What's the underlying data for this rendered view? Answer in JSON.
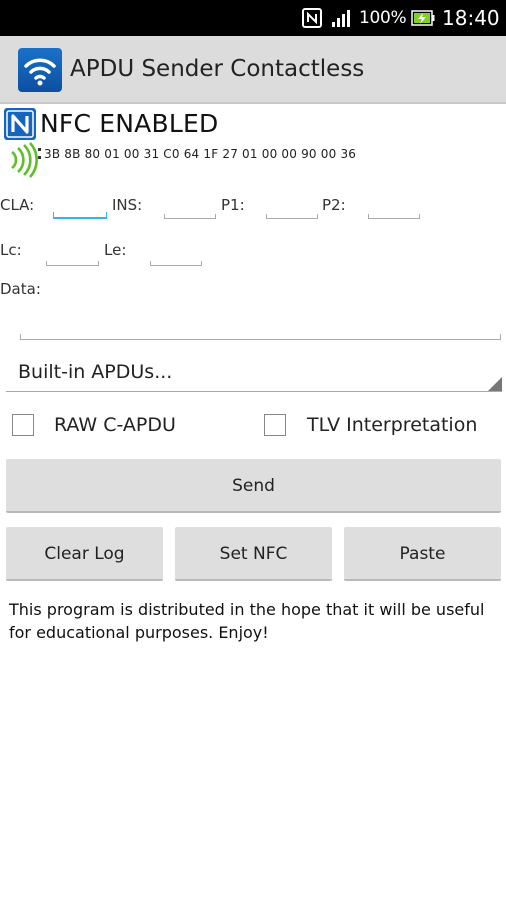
{
  "status_bar": {
    "battery_percent": "100%",
    "time": "18:40",
    "icons": [
      "nfc-icon",
      "signal-icon",
      "battery-charging-icon"
    ]
  },
  "action_bar": {
    "title": "APDU Sender Contactless",
    "icon": "wireless-app-icon"
  },
  "nfc": {
    "status": "NFC ENABLED",
    "atr": "3B 8B 80 01 00 31 C0 64 1F 27 01 00 00 90 00 36"
  },
  "apdu": {
    "cla_label": "CLA:",
    "ins_label": "INS:",
    "p1_label": "P1:",
    "p2_label": "P2:",
    "lc_label": "Lc:",
    "le_label": "Le:",
    "data_label": "Data:",
    "cla_value": "",
    "ins_value": "",
    "p1_value": "",
    "p2_value": "",
    "lc_value": "",
    "le_value": "",
    "data_value": ""
  },
  "spinner": {
    "selected": "Built-in APDUs..."
  },
  "options": {
    "raw_label": "RAW C-APDU",
    "raw_checked": false,
    "tlv_label": "TLV Interpretation",
    "tlv_checked": false
  },
  "buttons": {
    "send": "Send",
    "clear_log": "Clear Log",
    "set_nfc": "Set NFC",
    "paste": "Paste"
  },
  "log": {
    "text": "This program is distributed in the hope that it will be useful for educational purposes.  Enjoy!"
  },
  "colors": {
    "accent": "#33b5e5",
    "nfc_blue": "#1565c0",
    "wave_green": "#5fbf2a",
    "button_bg": "#dedede",
    "action_bar_bg": "#dcdcdc"
  }
}
